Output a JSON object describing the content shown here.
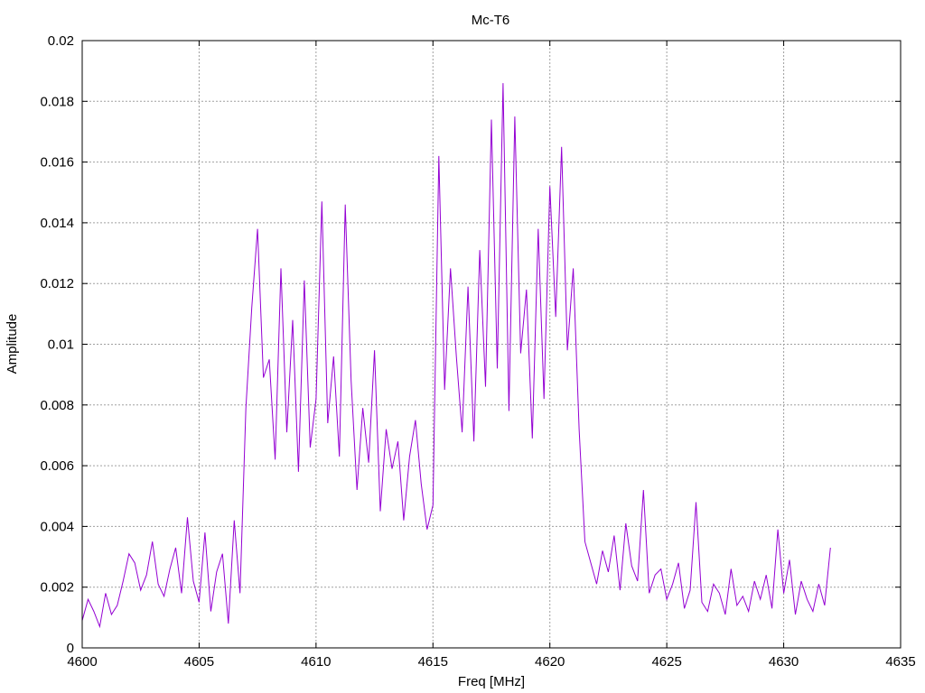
{
  "chart_data": {
    "type": "line",
    "title": "Mc-T6",
    "xlabel": "Freq [MHz]",
    "ylabel": "Amplitude",
    "xlim": [
      4600,
      4635
    ],
    "ylim": [
      0,
      0.02
    ],
    "xticks": [
      4600,
      4605,
      4610,
      4615,
      4620,
      4625,
      4630,
      4635
    ],
    "yticks": [
      0,
      0.002,
      0.004,
      0.006,
      0.008,
      0.01,
      0.012,
      0.014,
      0.016,
      0.018,
      0.02
    ],
    "xtick_labels": [
      "4600",
      "4605",
      "4610",
      "4615",
      "4620",
      "4625",
      "4630",
      "4635"
    ],
    "ytick_labels": [
      "0",
      "0.002",
      "0.004",
      "0.006",
      "0.008",
      "0.01",
      "0.012",
      "0.014",
      "0.016",
      "0.018",
      "0.02"
    ],
    "grid": true,
    "legend": "none",
    "series": [
      {
        "color": "#9400d3",
        "x": [
          4600.0,
          4600.25,
          4600.5,
          4600.75,
          4601.0,
          4601.25,
          4601.5,
          4601.75,
          4602.0,
          4602.25,
          4602.5,
          4602.75,
          4603.0,
          4603.25,
          4603.5,
          4603.75,
          4604.0,
          4604.25,
          4604.5,
          4604.75,
          4605.0,
          4605.25,
          4605.5,
          4605.75,
          4606.0,
          4606.25,
          4606.5,
          4606.75,
          4607.0,
          4607.25,
          4607.5,
          4607.75,
          4608.0,
          4608.25,
          4608.5,
          4608.75,
          4609.0,
          4609.25,
          4609.5,
          4609.75,
          4610.0,
          4610.25,
          4610.5,
          4610.75,
          4611.0,
          4611.25,
          4611.5,
          4611.75,
          4612.0,
          4612.25,
          4612.5,
          4612.75,
          4613.0,
          4613.25,
          4613.5,
          4613.75,
          4614.0,
          4614.25,
          4614.5,
          4614.75,
          4615.0,
          4615.25,
          4615.5,
          4615.75,
          4616.0,
          4616.25,
          4616.5,
          4616.75,
          4617.0,
          4617.25,
          4617.5,
          4617.75,
          4618.0,
          4618.25,
          4618.5,
          4618.75,
          4619.0,
          4619.25,
          4619.5,
          4619.75,
          4620.0,
          4620.25,
          4620.5,
          4620.75,
          4621.0,
          4621.25,
          4621.5,
          4621.75,
          4622.0,
          4622.25,
          4622.5,
          4622.75,
          4623.0,
          4623.25,
          4623.5,
          4623.75,
          4624.0,
          4624.25,
          4624.5,
          4624.75,
          4625.0,
          4625.25,
          4625.5,
          4625.75,
          4626.0,
          4626.25,
          4626.5,
          4626.75,
          4627.0,
          4627.25,
          4627.5,
          4627.75,
          4628.0,
          4628.25,
          4628.5,
          4628.75,
          4629.0,
          4629.25,
          4629.5,
          4629.75,
          4630.0,
          4630.25,
          4630.5,
          4630.75,
          4631.0,
          4631.25,
          4631.5,
          4631.75,
          4632.0
        ],
        "y": [
          0.0009,
          0.0016,
          0.0012,
          0.0007,
          0.0018,
          0.0011,
          0.0014,
          0.0022,
          0.0031,
          0.0028,
          0.0019,
          0.0024,
          0.0035,
          0.0021,
          0.0017,
          0.0026,
          0.0033,
          0.0018,
          0.0043,
          0.0022,
          0.0015,
          0.0038,
          0.0012,
          0.0025,
          0.0031,
          0.0008,
          0.0042,
          0.0018,
          0.0079,
          0.0112,
          0.0138,
          0.0089,
          0.0095,
          0.0062,
          0.0125,
          0.0071,
          0.0108,
          0.0058,
          0.0121,
          0.0066,
          0.0082,
          0.0147,
          0.0074,
          0.0096,
          0.0063,
          0.0146,
          0.0088,
          0.0052,
          0.0079,
          0.0061,
          0.0098,
          0.0045,
          0.0072,
          0.0059,
          0.0068,
          0.0042,
          0.0063,
          0.0075,
          0.0054,
          0.0039,
          0.0047,
          0.0162,
          0.0085,
          0.0125,
          0.0096,
          0.0071,
          0.0119,
          0.0068,
          0.0131,
          0.0086,
          0.0174,
          0.0092,
          0.0186,
          0.0078,
          0.0175,
          0.0097,
          0.0118,
          0.0069,
          0.0138,
          0.0082,
          0.0152,
          0.0109,
          0.0165,
          0.0098,
          0.0125,
          0.0072,
          0.0035,
          0.0028,
          0.0021,
          0.0032,
          0.0025,
          0.0037,
          0.0019,
          0.0041,
          0.0027,
          0.0022,
          0.0052,
          0.0018,
          0.0024,
          0.0026,
          0.0016,
          0.0021,
          0.0028,
          0.0013,
          0.0019,
          0.0048,
          0.0015,
          0.0012,
          0.0021,
          0.0018,
          0.0011,
          0.0026,
          0.0014,
          0.0017,
          0.0012,
          0.0022,
          0.0016,
          0.0024,
          0.0013,
          0.0039,
          0.0018,
          0.0029,
          0.0011,
          0.0022,
          0.0016,
          0.0012,
          0.0021,
          0.0014,
          0.0033
        ]
      }
    ]
  }
}
